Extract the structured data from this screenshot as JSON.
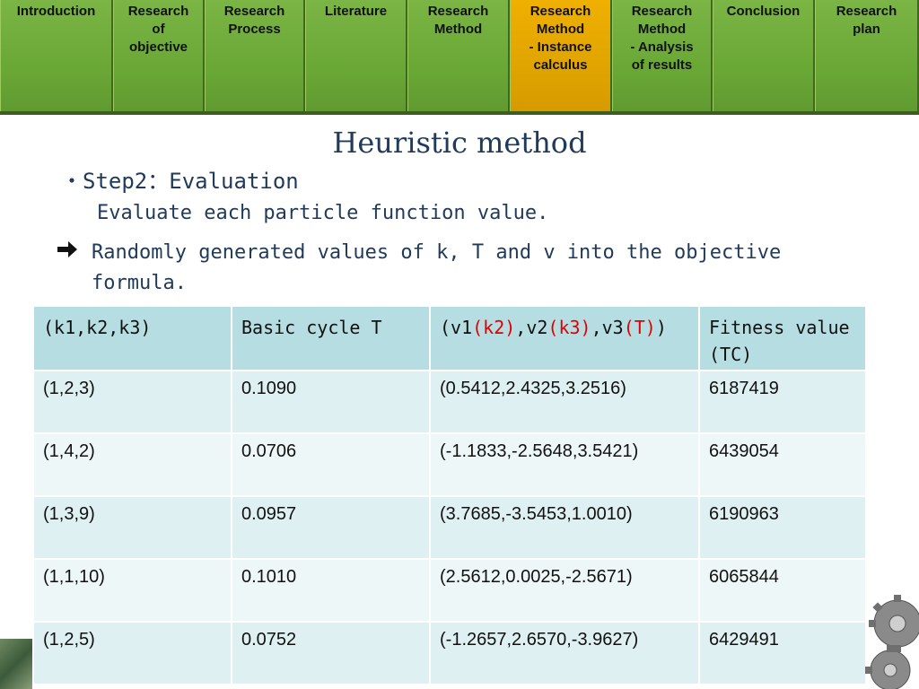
{
  "nav": {
    "tabs": [
      {
        "label": "Introduction",
        "active": false
      },
      {
        "label": "Research\nof\nobjective",
        "active": false
      },
      {
        "label": "Research\nProcess",
        "active": false
      },
      {
        "label": "Literature",
        "active": false
      },
      {
        "label": "Research\nMethod",
        "active": false
      },
      {
        "label": "Research\nMethod\n- Instance\ncalculus",
        "active": true
      },
      {
        "label": "Research\nMethod\n- Analysis\nof results",
        "active": false
      },
      {
        "label": "Conclusion",
        "active": false
      },
      {
        "label": "Research\nplan",
        "active": false
      }
    ]
  },
  "slide": {
    "title": "Heuristic method",
    "bullet": "・Step2：Evaluation",
    "sub": "Evaluate each particle function value.",
    "arrow_icon": "right-arrow-icon",
    "arrow_text": "Randomly generated values of k, T and v into the objective formula."
  },
  "table": {
    "headers": {
      "col1": "(k1,k2,k3)",
      "col2": "Basic cycle T",
      "col3": {
        "p1": "(v1",
        "r1": "(k2)",
        "p2": ",v2",
        "r2": "(k3)",
        "p3": ",v3",
        "r3": "(T)",
        "p4": ")"
      },
      "col4": "Fitness value (TC)"
    },
    "rows": [
      [
        "(1,2,3)",
        "0.1090",
        "(0.5412,2.4325,3.2516)",
        "6187419"
      ],
      [
        "(1,4,2)",
        "0.0706",
        "(-1.1833,-2.5648,3.5421)",
        "6439054"
      ],
      [
        "(1,3,9)",
        "0.0957",
        "(3.7685,-3.5453,1.0010)",
        "6190963"
      ],
      [
        "(1,1,10)",
        "0.1010",
        "(2.5612,0.0025,-2.5671)",
        "6065844"
      ],
      [
        "(1,2,5)",
        "0.0752",
        "(-1.2657,2.6570,-3.9627)",
        "6429491"
      ]
    ]
  },
  "colors": {
    "tab_green": "#6aa836",
    "tab_active": "#e0a400",
    "title_navy": "#1f3a5a",
    "header_bg": "#b5dde2",
    "row_bg": "#dff0f2",
    "highlight_red": "#e00000"
  },
  "decor": {
    "gear_icon": "gear-icon"
  }
}
